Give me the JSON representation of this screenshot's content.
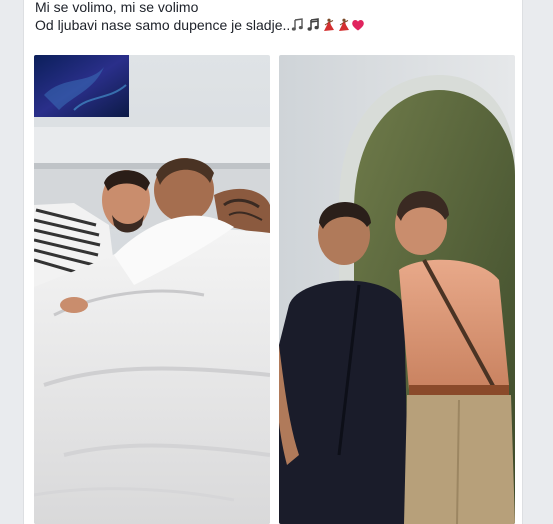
{
  "post": {
    "text_line_1": "Mi se volimo, mi se volimo",
    "text_line_2": "Od ljubavi nase samo dupence je sladje..",
    "emojis": [
      "musical-notes-icon",
      "musical-note-icon",
      "dancer-icon",
      "dancer-icon",
      "red-heart-icon"
    ]
  },
  "colors": {
    "page_bg": "#e9ebee",
    "card_bg": "#ffffff",
    "text": "#1d2129",
    "heart": "#e0245e",
    "dancer": "#d32f2f"
  },
  "photos": [
    {
      "name": "photo-bed-scene"
    },
    {
      "name": "photo-doorway-scene"
    }
  ]
}
